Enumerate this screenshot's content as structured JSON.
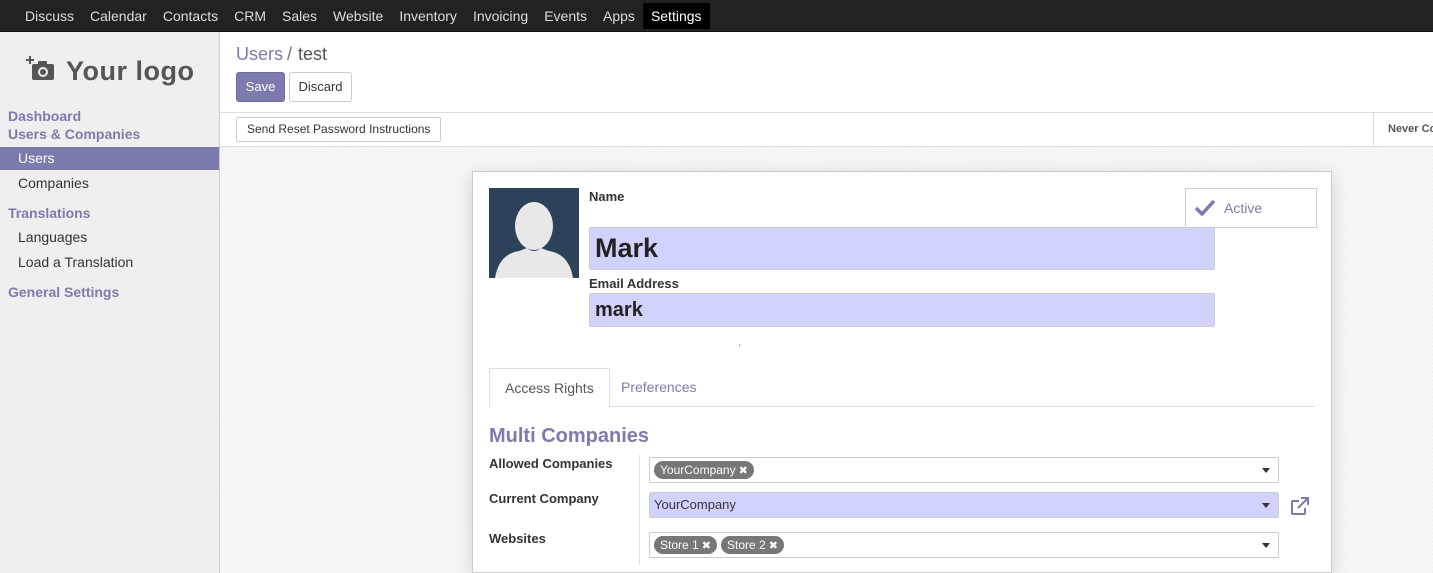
{
  "topnav": {
    "items": [
      "Discuss",
      "Calendar",
      "Contacts",
      "CRM",
      "Sales",
      "Website",
      "Inventory",
      "Invoicing",
      "Events",
      "Apps",
      "Settings"
    ],
    "active": "Settings"
  },
  "sidebar": {
    "logo_text": "Your logo",
    "sections": {
      "dashboard": "Dashboard",
      "users_companies": "Users & Companies",
      "translations": "Translations",
      "general_settings": "General Settings"
    },
    "items": {
      "users": "Users",
      "companies": "Companies",
      "languages": "Languages",
      "load_translation": "Load a Translation"
    }
  },
  "breadcrumb": {
    "parent": "Users",
    "separator": "/",
    "current": "test"
  },
  "buttons": {
    "save": "Save",
    "discard": "Discard",
    "reset_password": "Send Reset Password Instructions"
  },
  "status": {
    "login_info": "Never Co"
  },
  "form": {
    "name_label": "Name",
    "name_value": "Mark",
    "email_label": "Email Address",
    "email_value": "mark",
    "active_label": "Active",
    "tabs": [
      "Access Rights",
      "Preferences"
    ],
    "section_title": "Multi Companies",
    "allowed_companies_label": "Allowed Companies",
    "allowed_companies": [
      "YourCompany"
    ],
    "current_company_label": "Current Company",
    "current_company": "YourCompany",
    "websites_label": "Websites",
    "websites": [
      "Store 1",
      "Store 2"
    ],
    "tag_remove_symbol": "✖"
  },
  "colors": {
    "accent": "#7c7bad",
    "highlight": "#d2d2ff",
    "topbar": "#222222"
  }
}
